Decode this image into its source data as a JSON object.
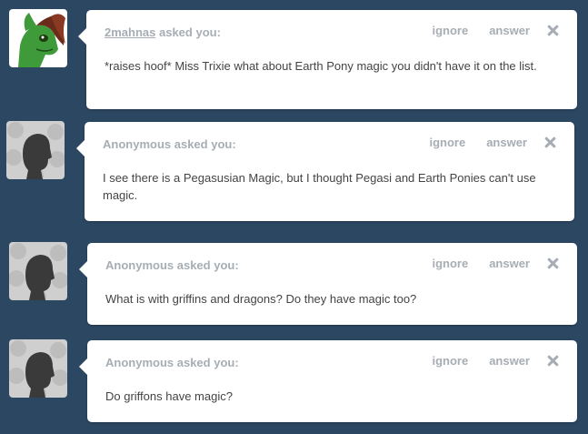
{
  "actions": {
    "ignore": "ignore",
    "answer": "answer"
  },
  "questions": [
    {
      "asker": "2mahnas",
      "asked_suffix": " asked you:",
      "avatar": "pony-avatar-icon",
      "text": "*raises hoof* Miss Trixie what about Earth Pony magic you didn't have it on the list."
    },
    {
      "asker": "Anonymous",
      "asked_suffix": " asked you:",
      "avatar": "anonymous-silhouette-icon",
      "text": "I see there is a Pegasusian Magic, but I thought Pegasi and Earth Ponies can't use magic."
    },
    {
      "asker": "Anonymous",
      "asked_suffix": " asked you:",
      "avatar": "anonymous-silhouette-icon",
      "text": "What is with griffins and dragons? Do they have magic too?"
    },
    {
      "asker": "Anonymous",
      "asked_suffix": " asked you:",
      "avatar": "anonymous-silhouette-icon",
      "text": "Do griffons have magic?"
    }
  ]
}
